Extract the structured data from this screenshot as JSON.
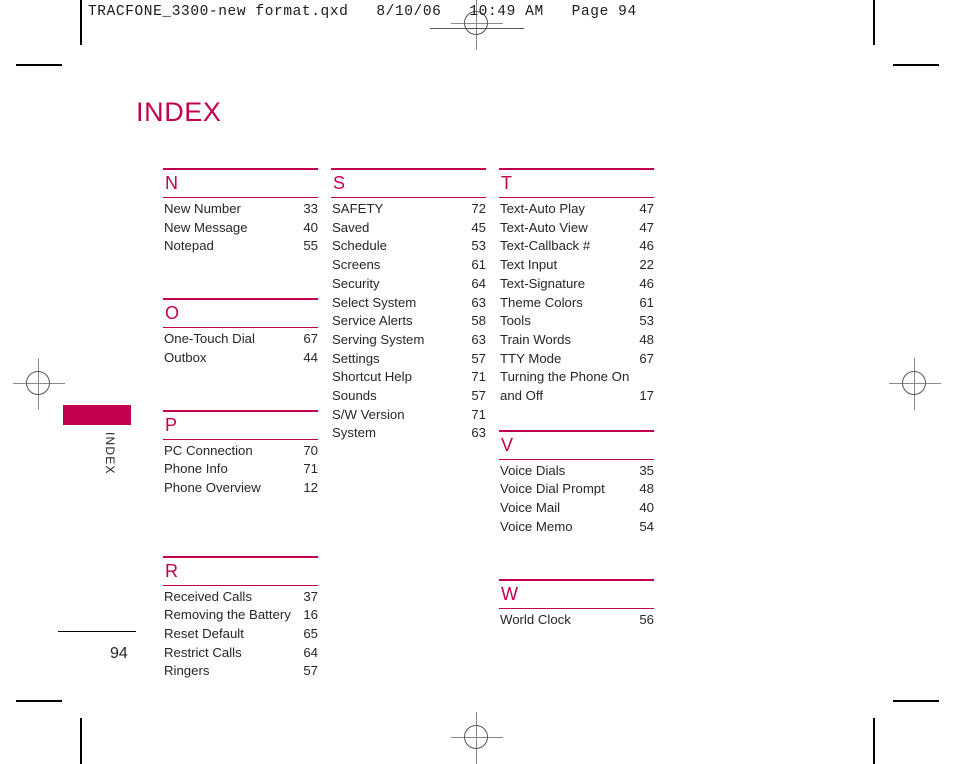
{
  "prepress": {
    "header_line": "TRACFONE_3300-new format.qxd   8/10/06   10:49 AM   Page 94"
  },
  "page": {
    "title": "INDEX",
    "edge_tab_label": "INDEX",
    "folio": "94"
  },
  "columns": [
    {
      "id": "column-1",
      "sections": [
        {
          "letter": "N",
          "entries": [
            {
              "label": "New Number",
              "page": "33"
            },
            {
              "label": "New Message",
              "page": "40"
            },
            {
              "label": "Notepad",
              "page": "55"
            }
          ]
        },
        {
          "letter": "O",
          "entries": [
            {
              "label": "One-Touch Dial",
              "page": "67"
            },
            {
              "label": "Outbox",
              "page": "44"
            }
          ]
        },
        {
          "letter": "P",
          "entries": [
            {
              "label": "PC Connection",
              "page": "70"
            },
            {
              "label": "Phone Info",
              "page": "71"
            },
            {
              "label": "Phone Overview",
              "page": "12"
            }
          ]
        },
        {
          "letter": "R",
          "entries": [
            {
              "label": "Received Calls",
              "page": "37"
            },
            {
              "label": "Removing the Battery",
              "page": "16"
            },
            {
              "label": "Reset Default",
              "page": "65"
            },
            {
              "label": "Restrict Calls",
              "page": "64"
            },
            {
              "label": "Ringers",
              "page": "57"
            }
          ]
        }
      ]
    },
    {
      "id": "column-2",
      "sections": [
        {
          "letter": "S",
          "entries": [
            {
              "label": "SAFETY",
              "page": "72"
            },
            {
              "label": "Saved",
              "page": "45"
            },
            {
              "label": "Schedule",
              "page": "53"
            },
            {
              "label": "Screens",
              "page": "61"
            },
            {
              "label": "Security",
              "page": "64"
            },
            {
              "label": "Select System",
              "page": "63"
            },
            {
              "label": "Service Alerts",
              "page": "58"
            },
            {
              "label": "Serving System",
              "page": "63"
            },
            {
              "label": "Settings",
              "page": "57"
            },
            {
              "label": "Shortcut Help",
              "page": "71"
            },
            {
              "label": "Sounds",
              "page": "57"
            },
            {
              "label": "S/W Version",
              "page": "71"
            },
            {
              "label": "System",
              "page": "63"
            }
          ]
        }
      ]
    },
    {
      "id": "column-3",
      "sections": [
        {
          "letter": "T",
          "entries": [
            {
              "label": "Text-Auto Play",
              "page": "47"
            },
            {
              "label": "Text-Auto View",
              "page": "47"
            },
            {
              "label": "Text-Callback #",
              "page": "46"
            },
            {
              "label": "Text Input",
              "page": "22"
            },
            {
              "label": "Text-Signature",
              "page": "46"
            },
            {
              "label": "Theme Colors",
              "page": "61"
            },
            {
              "label": "Tools",
              "page": "53"
            },
            {
              "label": "Train Words",
              "page": "48"
            },
            {
              "label": "TTY Mode",
              "page": "67"
            },
            {
              "label": "Turning the Phone On and Off",
              "page": "17",
              "wrap": true
            }
          ]
        },
        {
          "letter": "V",
          "entries": [
            {
              "label": "Voice Dials",
              "page": "35"
            },
            {
              "label": "Voice Dial Prompt",
              "page": "48"
            },
            {
              "label": "Voice Mail",
              "page": "40"
            },
            {
              "label": "Voice Memo",
              "page": "54"
            }
          ]
        },
        {
          "letter": "W",
          "entries": [
            {
              "label": "World Clock",
              "page": "56"
            }
          ]
        }
      ]
    }
  ],
  "colors": {
    "accent": "#c2004f",
    "text": "#262626",
    "marks": "#000000"
  }
}
